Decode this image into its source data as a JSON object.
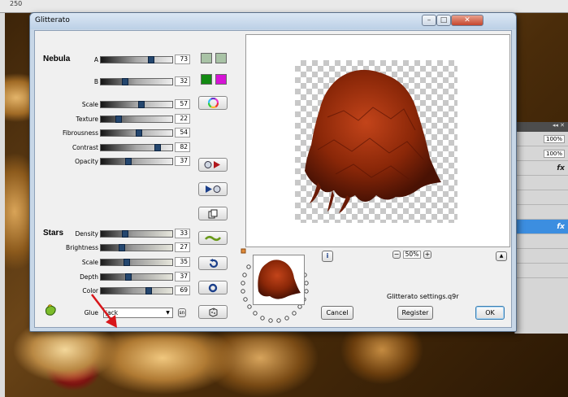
{
  "host": {
    "ruler_tick": "250",
    "zoom_values": [
      "100%",
      "100%"
    ],
    "fx_label": "fx"
  },
  "dialog": {
    "title": "Glitterato",
    "window_buttons": {
      "minimize": "–",
      "maximize": "□",
      "close": "✕"
    },
    "nebula": {
      "title": "Nebula",
      "params": [
        {
          "label": "A",
          "value": "73",
          "level": 73
        },
        {
          "label": "B",
          "value": "32",
          "level": 32
        },
        {
          "label": "Scale",
          "value": "57",
          "level": 57
        },
        {
          "label": "Texture",
          "value": "22",
          "level": 22
        },
        {
          "label": "Fibrousness",
          "value": "54",
          "level": 54
        },
        {
          "label": "Contrast",
          "value": "82",
          "level": 82
        },
        {
          "label": "Opacity",
          "value": "37",
          "level": 37
        }
      ],
      "color_a": [
        "#a9c3a6",
        "#a9c3a6"
      ],
      "color_b": [
        "#138a13",
        "#d614d6"
      ]
    },
    "stars": {
      "title": "Stars",
      "params": [
        {
          "label": "Density",
          "value": "33",
          "level": 33
        },
        {
          "label": "Brightness",
          "value": "27",
          "level": 27
        },
        {
          "label": "Scale",
          "value": "35",
          "level": 35
        },
        {
          "label": "Depth",
          "value": "37",
          "level": 37
        },
        {
          "label": "Color",
          "value": "69",
          "level": 69
        }
      ]
    },
    "glue": {
      "label": "Glue",
      "value": "jack",
      "extra_button": "sn"
    },
    "preview": {
      "zoom_minus": "−",
      "zoom_value": "50%",
      "zoom_plus": "+",
      "info": "i",
      "collapse": "▲"
    },
    "preset_name": "Glitterato settings.q9r",
    "buttons": {
      "cancel": "Cancel",
      "register": "Register",
      "ok": "OK"
    }
  }
}
